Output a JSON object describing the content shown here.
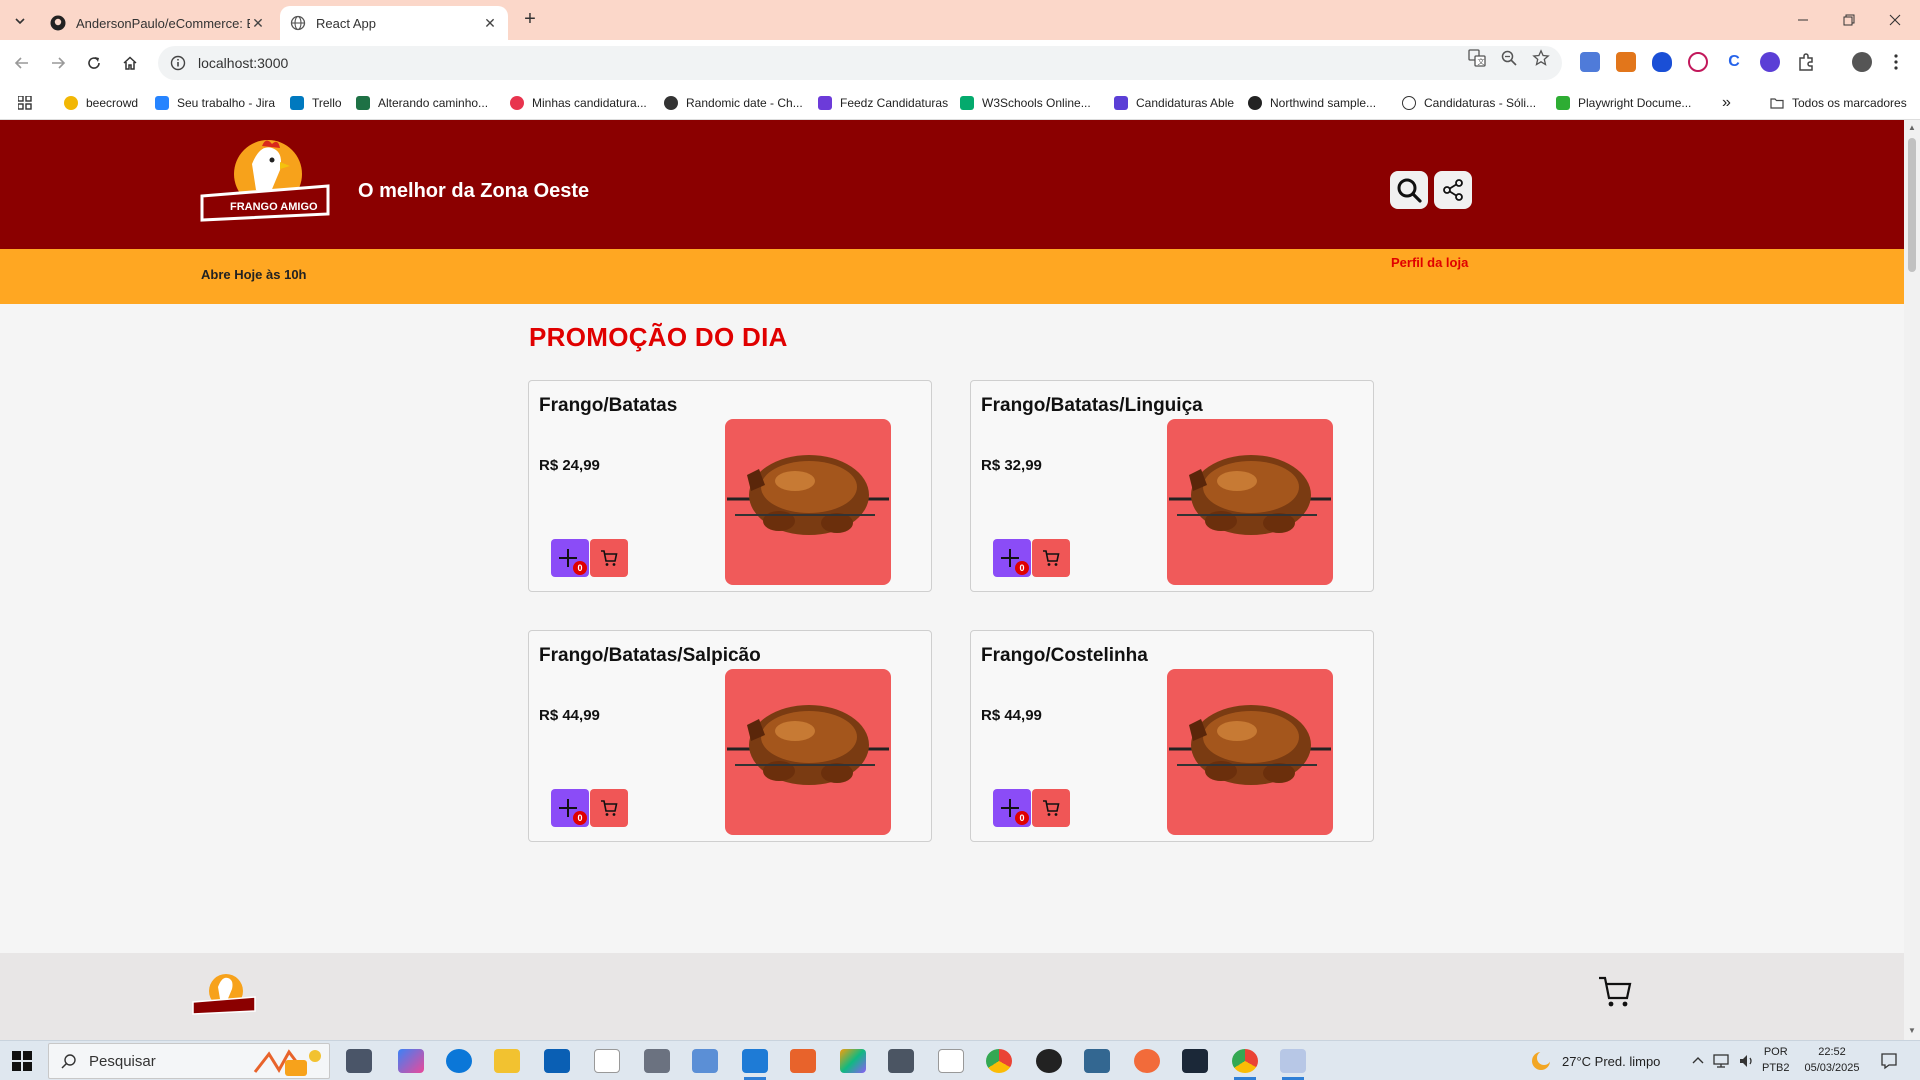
{
  "browser": {
    "tabs": [
      {
        "title": "AndersonPaulo/eCommerce: EC",
        "active": false
      },
      {
        "title": "React App",
        "active": true
      }
    ],
    "new_tab_symbol": "+",
    "close_symbol": "✕",
    "url": "localhost:3000",
    "bookmarks": [
      {
        "label": "beecrowd",
        "icon": "beecrowd-icon",
        "color": "#f2b705"
      },
      {
        "label": "Seu trabalho - Jira",
        "icon": "jira-icon",
        "color": "#2684ff"
      },
      {
        "label": "Trello",
        "icon": "trello-icon",
        "color": "#0079bf"
      },
      {
        "label": "Alterando caminho...",
        "icon": "excel-icon",
        "color": "#1e7145"
      },
      {
        "label": "Minhas candidatura...",
        "icon": "gupy-icon",
        "color": "#e8344e"
      },
      {
        "label": "Randomic date - Ch...",
        "icon": "chatgpt-icon",
        "color": "#333333"
      },
      {
        "label": "Feedz Candidaturas",
        "icon": "feedz-icon",
        "color": "#6c3bd9"
      },
      {
        "label": "W3Schools Online...",
        "icon": "w3schools-icon",
        "color": "#04aa6d"
      },
      {
        "label": "Candidaturas Able",
        "icon": "able-icon",
        "color": "#5b3fd6"
      },
      {
        "label": "Northwind sample...",
        "icon": "github-icon",
        "color": "#222222"
      },
      {
        "label": "Candidaturas - Sóli...",
        "icon": "globe-icon",
        "color": "#333333"
      },
      {
        "label": "Playwright Docume...",
        "icon": "playwright-icon",
        "color": "#2ead33"
      }
    ],
    "bookmarks_overflow": "»",
    "all_bookmarks": "Todos os marcadores"
  },
  "store": {
    "slogan": "O melhor da Zona Oeste",
    "opening": "Abre Hoje às 10h",
    "profile_link": "Perfil da loja",
    "brand_color": "#8b0000",
    "accent_color": "#ffa722",
    "logo_text": "FRANGO AMIGO"
  },
  "promo": {
    "title": "PROMOÇÃO DO DIA",
    "products": [
      {
        "name": "Frango/Batatas",
        "price": "R$ 24,99",
        "qty": "0"
      },
      {
        "name": "Frango/Batatas/Linguiça",
        "price": "R$ 32,99",
        "qty": "0"
      },
      {
        "name": "Frango/Batatas/Salpicão",
        "price": "R$ 44,99",
        "qty": "0"
      },
      {
        "name": "Frango/Costelinha",
        "price": "R$ 44,99",
        "qty": "0"
      }
    ]
  },
  "taskbar": {
    "search_placeholder": "Pesquisar",
    "weather": "27°C  Pred. limpo",
    "lang_line1": "POR",
    "lang_line2": "PTB2",
    "time": "22:52",
    "date": "05/03/2025"
  }
}
